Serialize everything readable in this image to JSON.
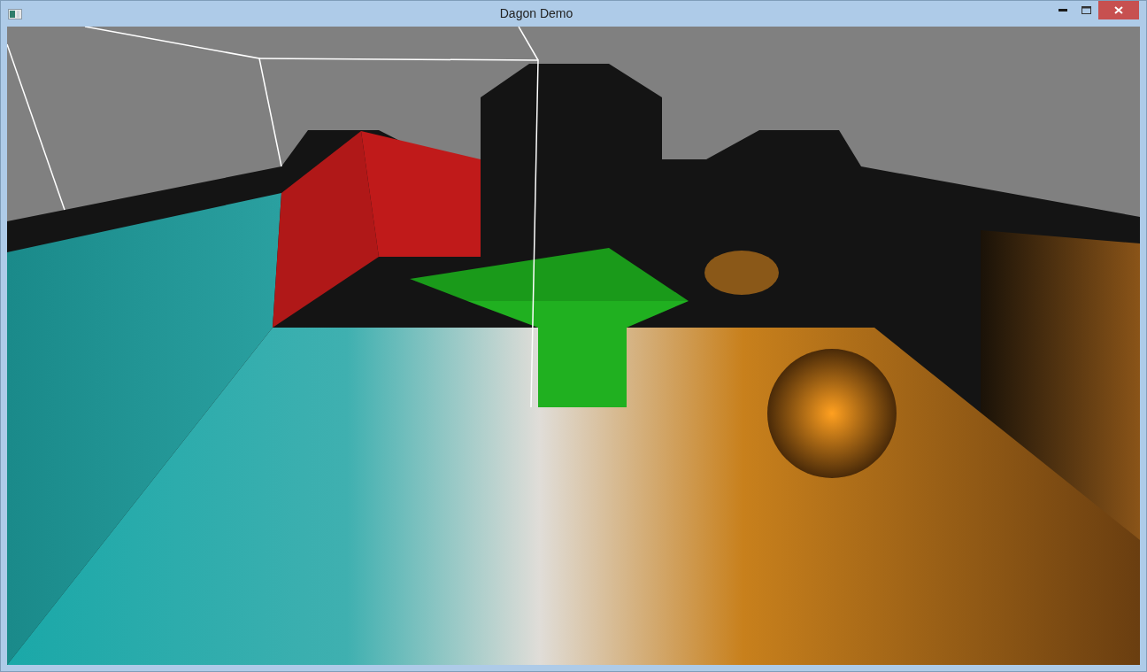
{
  "window": {
    "title": "Dagon Demo"
  }
}
